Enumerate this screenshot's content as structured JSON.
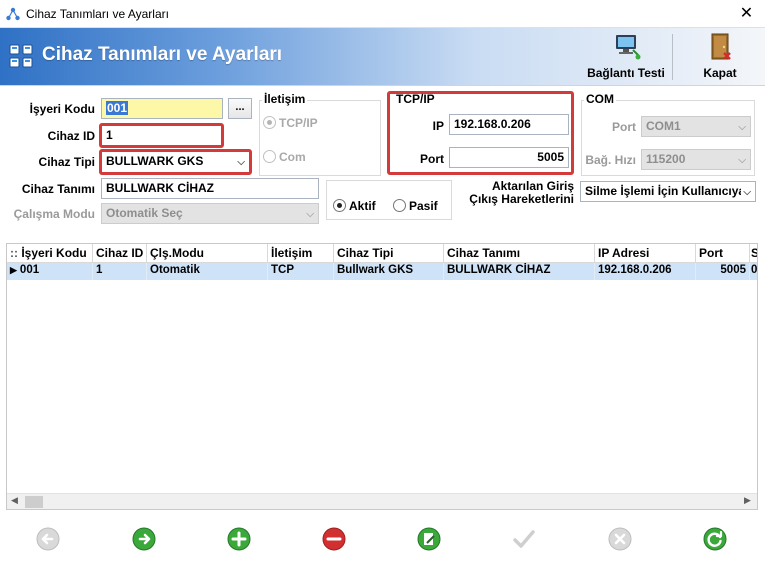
{
  "window": {
    "title": "Cihaz Tanımları ve Ayarları",
    "close_label": "✕"
  },
  "header": {
    "title": "Cihaz Tanımları ve Ayarları",
    "buttons": [
      {
        "label": "Bağlantı Testi",
        "icon": "network-computer-icon"
      },
      {
        "label": "Kapat",
        "icon": "exit-door-icon"
      }
    ]
  },
  "form": {
    "isyeri_kodu": {
      "label": "İşyeri Kodu",
      "value": "001",
      "browse_label": "..."
    },
    "cihaz_id": {
      "label": "Cihaz ID",
      "value": "1"
    },
    "cihaz_tipi": {
      "label": "Cihaz Tipi",
      "value": "BULLWARK GKS"
    },
    "cihaz_tanimi": {
      "label": "Cihaz Tanımı",
      "value": "BULLWARK CİHAZ"
    },
    "calisma_modu": {
      "label": "Çalışma Modu",
      "value": "Otomatik Seç"
    },
    "iletisim": {
      "title": "İletişim",
      "options": [
        "TCP/IP",
        "Com"
      ],
      "selected": "TCP/IP"
    },
    "tcpip": {
      "title": "TCP/IP",
      "ip_label": "IP",
      "ip_value": "192.168.0.206",
      "port_label": "Port",
      "port_value": "5005"
    },
    "com": {
      "title": "COM",
      "port_label": "Port",
      "port_value": "COM1",
      "baud_label": "Bağ. Hızı",
      "baud_value": "115200"
    },
    "durum": {
      "options": [
        "Aktif",
        "Pasif"
      ],
      "selected": "Aktif"
    },
    "aktarilan": {
      "label_line1": "Aktarılan Giriş",
      "label_line2": "Çıkış Hareketlerini",
      "value": "Silme İşlemi İçin Kullanıcıya"
    }
  },
  "grid": {
    "columns": [
      "İşyeri Kodu",
      "Cihaz ID",
      "Çlş.Modu",
      "İletişim",
      "Cihaz Tipi",
      "Cihaz Tanımı",
      "IP Adresi",
      "Port",
      "S"
    ],
    "rows": [
      [
        "001",
        "1",
        "Otomatik",
        "TCP",
        "Bullwark GKS",
        "BULLWARK CİHAZ",
        "192.168.0.206",
        "5005",
        "0"
      ]
    ],
    "row_marker": "▶",
    "header_marker": "::"
  },
  "nav_buttons": [
    {
      "name": "previous-button",
      "icon": "arrow-left-icon",
      "enabled": false
    },
    {
      "name": "next-button",
      "icon": "arrow-right-icon",
      "enabled": true
    },
    {
      "name": "add-button",
      "icon": "plus-icon",
      "enabled": true
    },
    {
      "name": "delete-button",
      "icon": "minus-icon",
      "enabled": true
    },
    {
      "name": "edit-button",
      "icon": "edit-icon",
      "enabled": true
    },
    {
      "name": "save-button",
      "icon": "checkmark-icon",
      "enabled": false
    },
    {
      "name": "cancel-button",
      "icon": "x-icon",
      "enabled": false
    },
    {
      "name": "refresh-button",
      "icon": "refresh-icon",
      "enabled": true
    }
  ],
  "colors": {
    "header_gradient_start": "#2f71c5",
    "selection_row": "#cfe3f8",
    "highlight_border": "#d33a3a",
    "green_icon": "#3aa93a",
    "red_icon": "#d23030"
  }
}
